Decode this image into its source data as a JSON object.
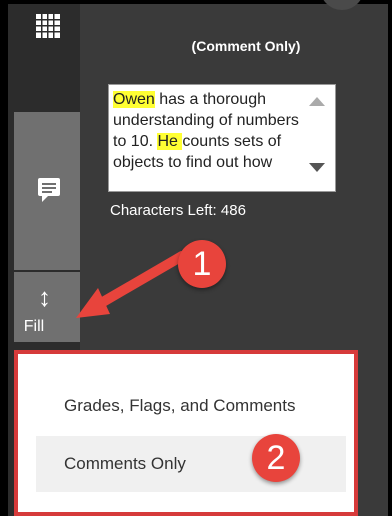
{
  "header": {
    "mode_label": "(Comment Only)"
  },
  "comment": {
    "text_parts": [
      {
        "text": "Owen",
        "highlight": true
      },
      {
        "text": " has a thorough understanding of numbers to 10. ",
        "highlight": false
      },
      {
        "text": "He ",
        "highlight": true
      },
      {
        "text": "counts sets of objects to find out how",
        "highlight": false
      }
    ],
    "chars_left": "Characters Left: 486"
  },
  "sidebar": {
    "fill_label": "Fill"
  },
  "callouts": {
    "one": "1",
    "two": "2"
  },
  "fill_menu": {
    "items": [
      {
        "label": "Grades, Flags, and Comments",
        "selected": false
      },
      {
        "label": "Comments Only",
        "selected": true
      }
    ]
  },
  "colors": {
    "accent_red": "#d63a3a",
    "highlight": "#ffff33",
    "badge": "#e8443c"
  }
}
